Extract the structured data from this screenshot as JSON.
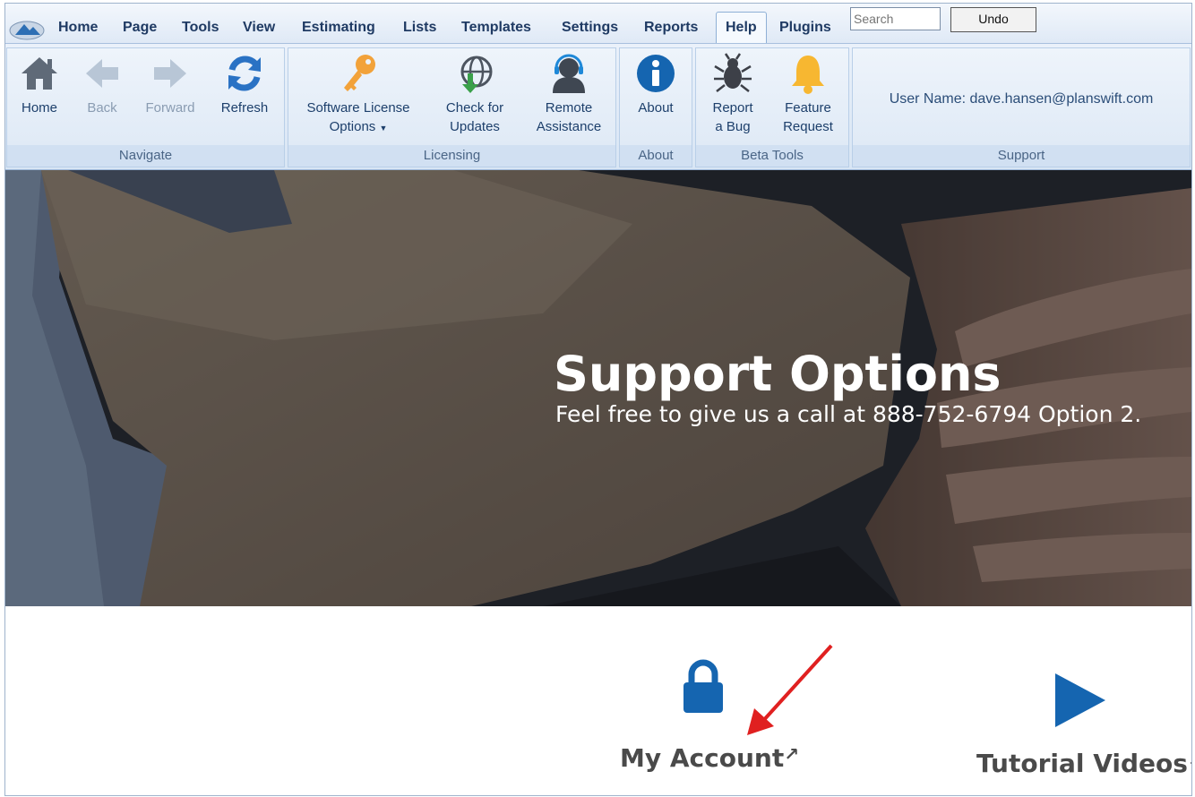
{
  "tabs": [
    "Home",
    "Page",
    "Tools",
    "View",
    "Estimating",
    "Lists",
    "Templates",
    "Settings",
    "Reports",
    "Help",
    "Plugins"
  ],
  "active_tab": "Help",
  "search": {
    "placeholder": "Search"
  },
  "undo_label": "Undo",
  "ribbon": {
    "navigate": {
      "label": "Navigate",
      "home": "Home",
      "back": "Back",
      "forward": "Forward",
      "refresh": "Refresh"
    },
    "licensing": {
      "label": "Licensing",
      "software_license_line1": "Software License",
      "software_license_line2": "Options",
      "check_updates_line1": "Check for",
      "check_updates_line2": "Updates",
      "remote_line1": "Remote",
      "remote_line2": "Assistance"
    },
    "about": {
      "label": "About",
      "about_button": "About"
    },
    "beta_tools": {
      "label": "Beta Tools",
      "report_bug_line1": "Report",
      "report_bug_line2": "a Bug",
      "feature_line1": "Feature",
      "feature_line2": "Request"
    },
    "support": {
      "label": "Support",
      "user_name": "User Name: dave.hansen@planswift.com"
    }
  },
  "hero": {
    "title": "Support Options",
    "subtitle": "Feel free to give us a call at 888-752-6794 Option 2."
  },
  "cards": {
    "my_account": "My Account",
    "tutorial_videos": "Tutorial Videos"
  },
  "colors": {
    "brand_blue": "#1565b0",
    "annotation_arrow": "#e02020",
    "key_orange": "#f2a23a"
  },
  "icons": {
    "home": "home-icon",
    "back": "arrow-left-icon",
    "forward": "arrow-right-icon",
    "refresh": "refresh-icon",
    "license": "key-icon",
    "updates": "globe-download-icon",
    "remote": "headset-icon",
    "about": "info-icon",
    "bug": "bug-icon",
    "feature": "bell-icon",
    "account": "lock-icon",
    "videos": "play-icon",
    "external": "external-link-icon"
  }
}
